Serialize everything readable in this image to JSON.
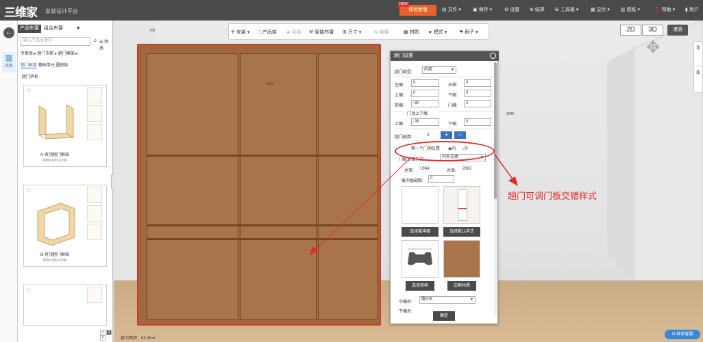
{
  "header": {
    "logo": "三维家",
    "slogan": "家装设计平台",
    "upgrade": {
      "new": "NEW",
      "label": "体验新版"
    },
    "menu": [
      {
        "icon": "file-icon",
        "label": "文件"
      },
      {
        "icon": "save-icon",
        "label": "保存"
      },
      {
        "icon": "settings-icon",
        "label": "设置"
      },
      {
        "icon": "bill-icon",
        "label": "结算"
      },
      {
        "icon": "toolbox-icon",
        "label": "工具箱"
      },
      {
        "icon": "display-icon",
        "label": "显示"
      },
      {
        "icon": "drawing-icon",
        "label": "图纸"
      },
      {
        "icon": "help-icon",
        "label": "帮助"
      },
      {
        "icon": "user-icon",
        "label": "用户"
      }
    ]
  },
  "rail": {
    "back": "←",
    "wardrobe_label": "衣柜"
  },
  "panel": {
    "tabs": [
      "产品布置",
      "组合布置",
      "★"
    ],
    "search_placeholder": "输入产品关键字",
    "filter": "筛选",
    "breadcrumbs": [
      "专家库 ▸",
      "趟门衣柜 ▸",
      "趟门框架 ▸"
    ],
    "categories": [
      "趟门框架",
      "基础单元",
      "圆搭板"
    ],
    "sub": "趟门挤柜",
    "cards": [
      {
        "name": "A-有顶趟门框架",
        "size": "2000×600×2100"
      },
      {
        "name": "B-有顶趟门框架",
        "size": "2000×600×2340"
      },
      {
        "name": "",
        "size": ""
      }
    ],
    "pager": [
      "<",
      "1",
      ">"
    ]
  },
  "toolbar": [
    {
      "icon": "install-icon",
      "label": "安装 ▾"
    },
    {
      "icon": "product-library-icon",
      "label": "产品库"
    },
    {
      "icon": "style-icon",
      "label": "风格"
    },
    {
      "icon": "smart-layout-icon",
      "label": "智能布置"
    },
    {
      "icon": "dimension-icon",
      "label": "尺寸 ▾"
    },
    {
      "icon": "replace-icon",
      "label": "替换"
    },
    {
      "icon": "material-icon",
      "label": "材质"
    },
    {
      "icon": "mode-icon",
      "label": "模式 ▾"
    },
    {
      "icon": "brush-icon",
      "label": "刷子 ▾"
    }
  ],
  "view": {
    "d2": "2D",
    "d3": "3D",
    "roam": "漫游"
  },
  "right_tabs": [
    "导",
    "效"
  ],
  "dims": {
    "top": "700",
    "width": "1964",
    "room": "6946"
  },
  "dialog": {
    "title": "趟门设置",
    "close": "×",
    "door_type_label": "趟门类型:",
    "door_type": "内嵌",
    "left_gap_label": "左缩:",
    "left_gap": "0",
    "right_gap_label": "右缩:",
    "right_gap": "0",
    "top_gap_label": "上缩:",
    "top_gap": "0",
    "bottom_gap_label": "下缩:",
    "bottom_gap": "0",
    "front_gap_label": "前缩:",
    "front_gap": "-80",
    "door_gap_label": "门缝:",
    "door_gap": "2",
    "door_ud_title": "门顶上下缩",
    "up_label": "上缩:",
    "up": "-38",
    "down_label": "下缩:",
    "down": "0",
    "door_count_label": "趟门扇数:",
    "door_count": "3",
    "plus": "+",
    "minus": "−",
    "first_pos_label": "第一个门洞位置",
    "radio_in": "内",
    "radio_out": "外",
    "stagger_label": "门板交错方式:",
    "stagger": "内外交错",
    "total_width_label": "总宽:",
    "total_width": "1964",
    "total_height_label": "总高:",
    "total_height": "2082",
    "buffer_label": "缓冲器副数:",
    "buffer": "0",
    "btn_buffer": "选择缓冲器",
    "btn_default_style": "选择默认样式",
    "btn_frame": "选择竖框",
    "btn_frame_material": "边框材质",
    "mid_label": "中横杀:",
    "mid": "路376",
    "bottom_label": "下横杀:",
    "confirm": "确定"
  },
  "annotation": "趟门可调门板交错样式",
  "status": {
    "area": "套内面积：63.36㎡"
  },
  "service": "联系客服",
  "colors": {
    "highlight": "#e02b2b",
    "accent": "#3a72c0",
    "wood": "#a9744a"
  }
}
